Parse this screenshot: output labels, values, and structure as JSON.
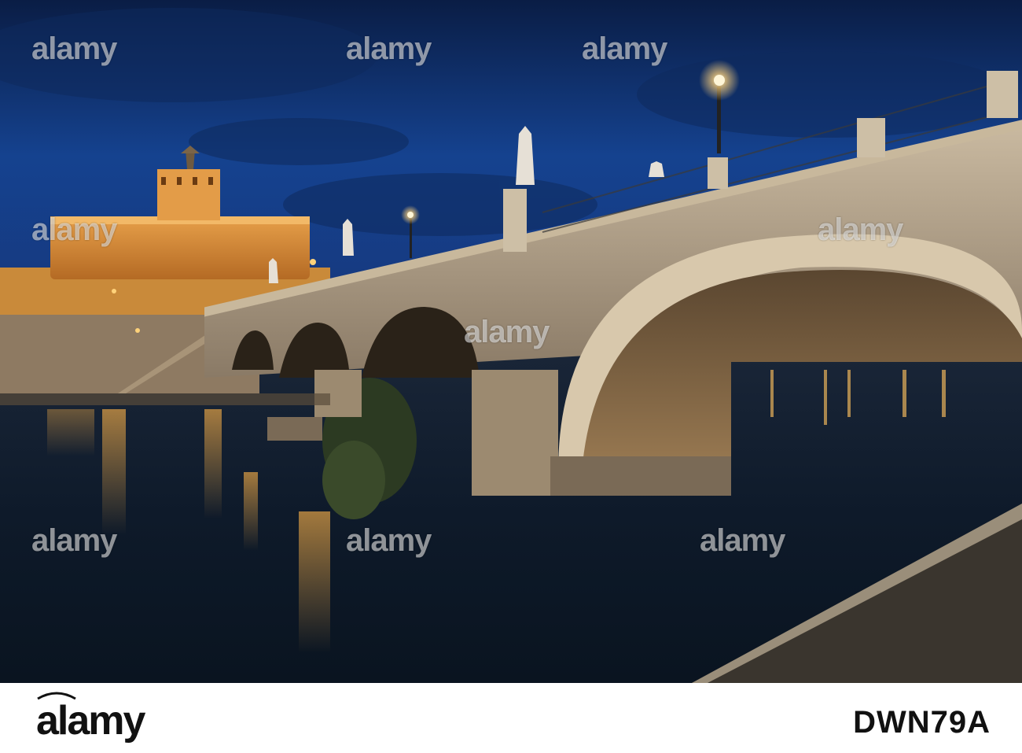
{
  "watermark": {
    "text": "alamy"
  },
  "footer": {
    "brand": "alamy",
    "image_id": "DWN79A"
  },
  "colors": {
    "sky_top": "#0b1f4a",
    "sky_mid": "#15428f",
    "sky_low": "#123a7a",
    "castle_glow": "#f0a53a",
    "stone_bridge": "#b9a890",
    "water": "#0c1a2c",
    "lamp": "#ffd98a"
  }
}
